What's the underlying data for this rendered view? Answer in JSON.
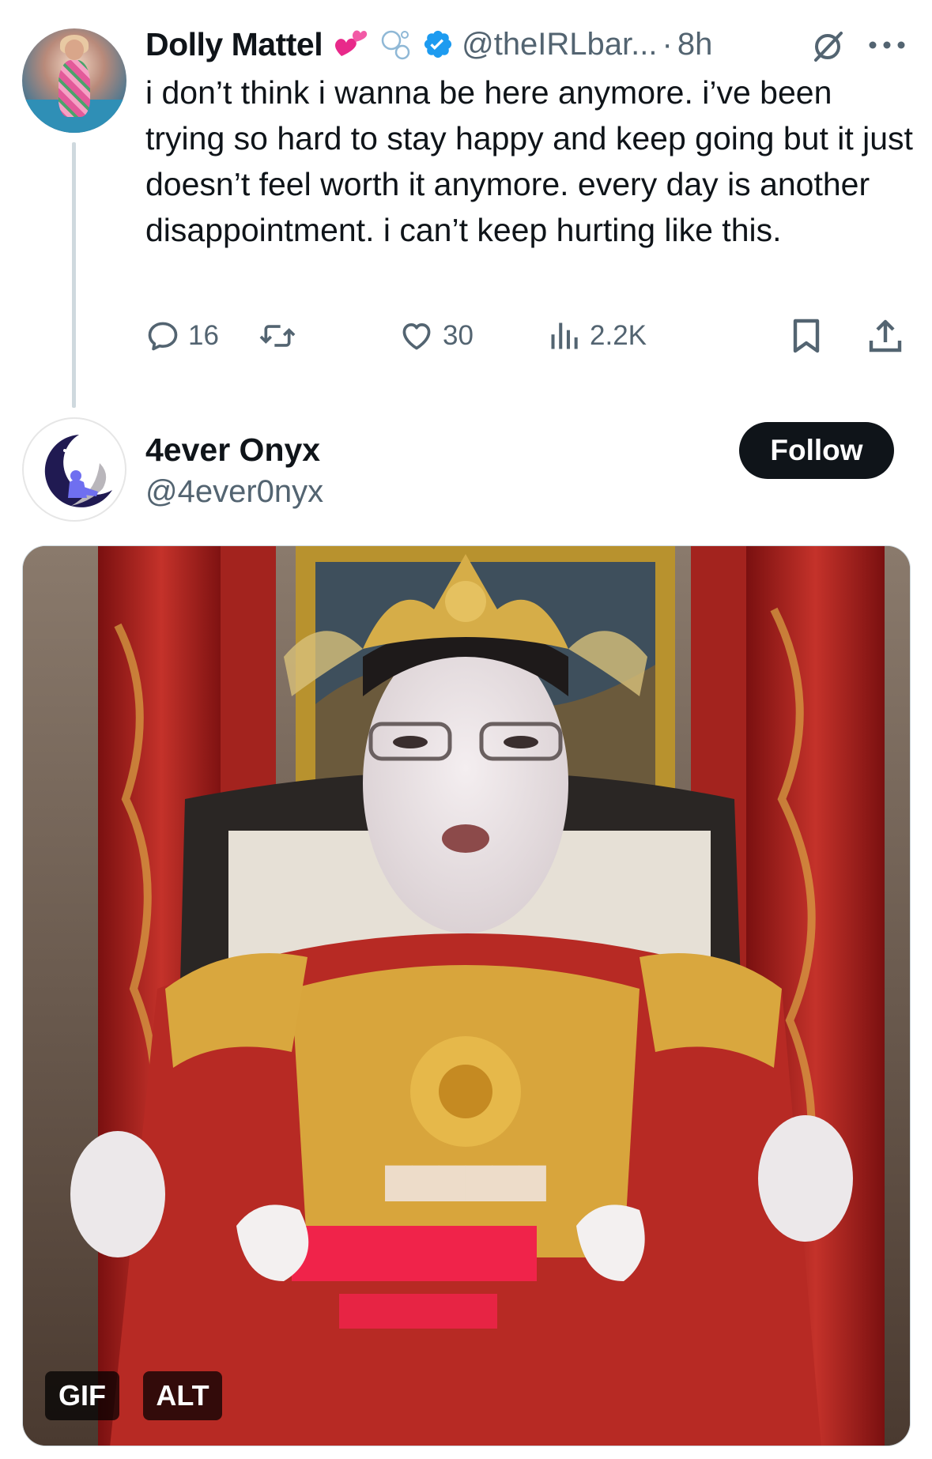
{
  "tweet1": {
    "author_name": "Dolly Mattel",
    "emojis": [
      "two-hearts-emoji",
      "bubbles-emoji"
    ],
    "handle": "@theIRLbar...",
    "separator": "·",
    "time": "8h",
    "text": "i don’t think i wanna be here anymore. i’ve been trying so hard to stay happy and keep going but it just doesn’t feel worth it anymore. every day is another disappointment. i can’t keep hurting like this.",
    "actions": {
      "replies": "16",
      "reposts": "",
      "likes": "30",
      "views": "2.2K"
    }
  },
  "tweet2": {
    "author_name": "4ever Onyx",
    "handle": "@4ever0nyx",
    "follow_label": "Follow",
    "media": {
      "gif_label": "GIF",
      "alt_label": "ALT"
    }
  },
  "colors": {
    "text": "#0f1419",
    "secondary": "#536471",
    "verified": "#1d9bf0",
    "button_bg": "#0f1419"
  }
}
